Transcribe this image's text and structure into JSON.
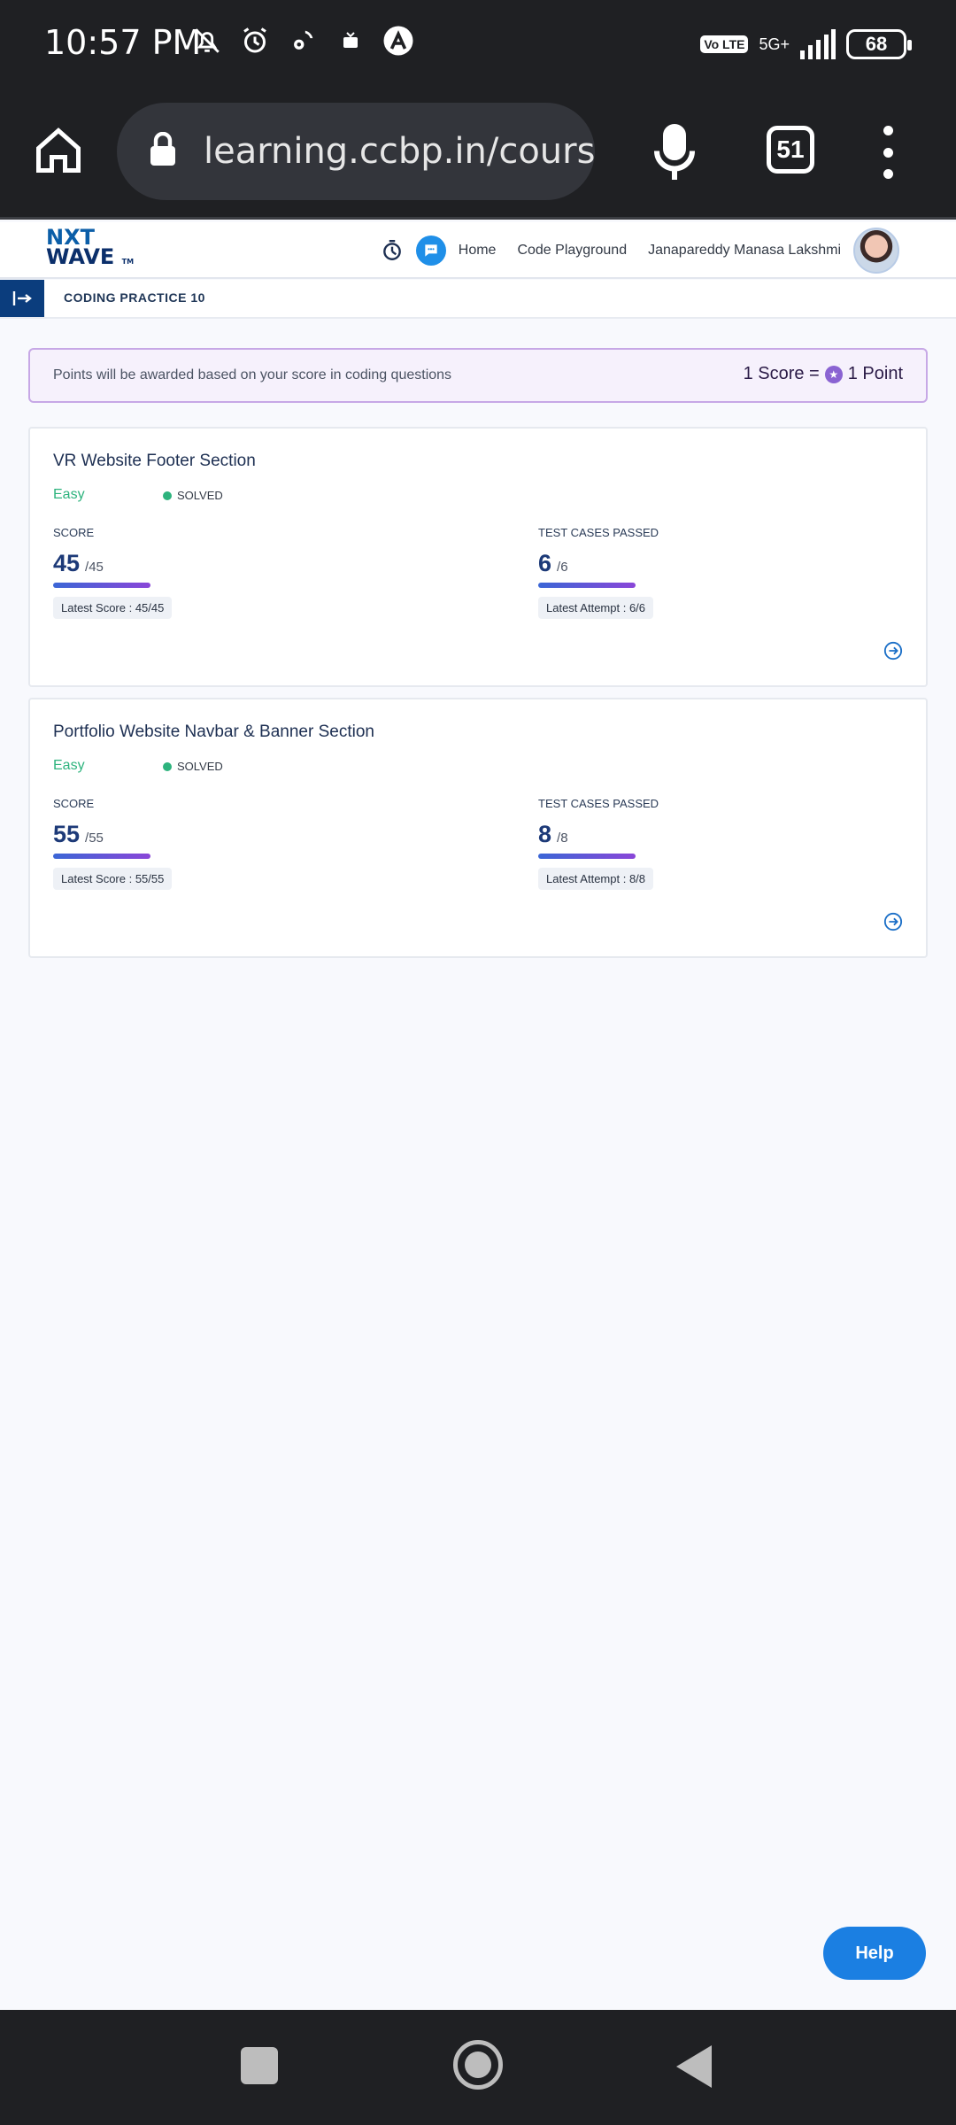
{
  "status_bar": {
    "time": "10:57 PM",
    "volte": "Vo LTE",
    "network": "5G+",
    "battery": "68"
  },
  "browser": {
    "url": "learning.ccbp.in/course",
    "tab_count": "51"
  },
  "header": {
    "logo_line1": "NXT",
    "logo_line2": "WAVE",
    "logo_tm": "TM",
    "nav_home": "Home",
    "nav_playground": "Code Playground",
    "user_name": "Janapareddy Manasa Lakshmi"
  },
  "breadcrumb": {
    "title": "CODING PRACTICE 10"
  },
  "points_banner": {
    "text": "Points will be awarded based on your score in coding questions",
    "left": "1 Score =",
    "right": "1 Point"
  },
  "cards": [
    {
      "title": "VR Website Footer Section",
      "difficulty": "Easy",
      "status": "SOLVED",
      "score_label": "SCORE",
      "score": "45",
      "score_total": "/45",
      "score_progress": 1.0,
      "latest_score": "Latest Score : 45/45",
      "tests_label": "TEST CASES PASSED",
      "tests": "6",
      "tests_total": "/6",
      "tests_progress": 1.0,
      "latest_attempt": "Latest Attempt : 6/6"
    },
    {
      "title": "Portfolio Website Navbar & Banner Section",
      "difficulty": "Easy",
      "status": "SOLVED",
      "score_label": "SCORE",
      "score": "55",
      "score_total": "/55",
      "score_progress": 1.0,
      "latest_score": "Latest Score : 55/55",
      "tests_label": "TEST CASES PASSED",
      "tests": "8",
      "tests_total": "/8",
      "tests_progress": 1.0,
      "latest_attempt": "Latest Attempt : 8/8"
    }
  ],
  "help": {
    "label": "Help"
  },
  "colors": {
    "accent": "#1b7fe2",
    "easy": "#2db37d",
    "header_blue": "#0b3d7d"
  }
}
